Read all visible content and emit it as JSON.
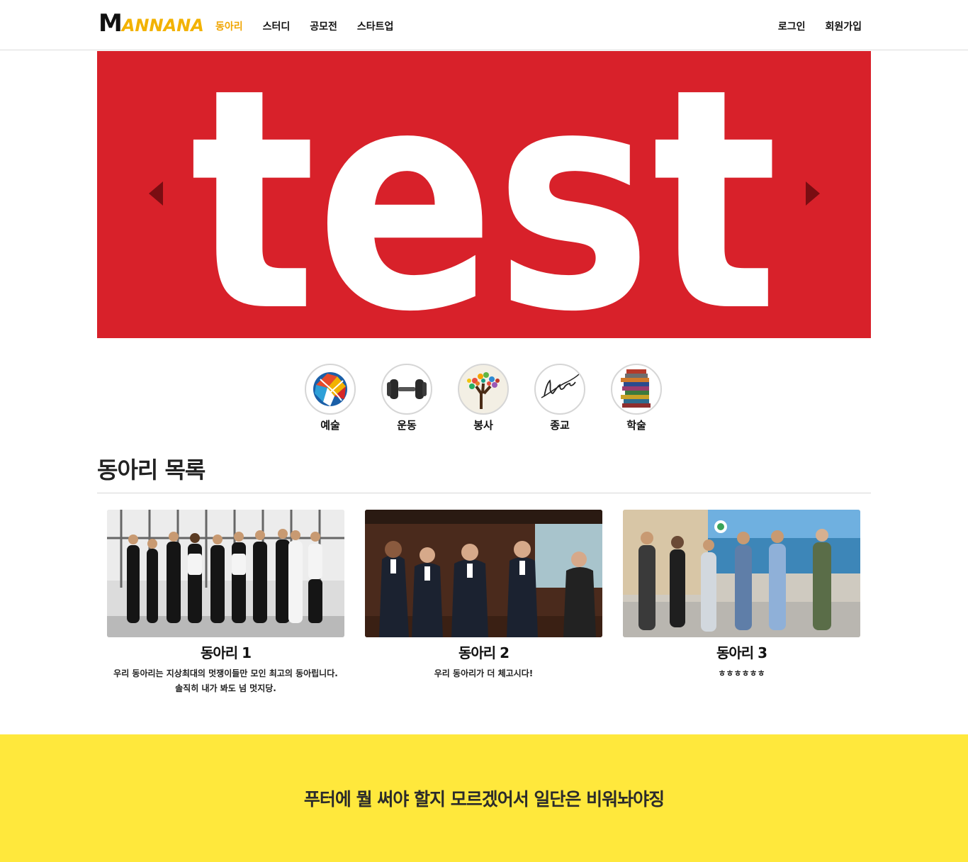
{
  "nav": {
    "logo_first": "M",
    "logo_rest": "ANNANA",
    "menu": [
      {
        "label": "동아리"
      },
      {
        "label": "스터디"
      },
      {
        "label": "공모전"
      },
      {
        "label": "스타트업"
      }
    ],
    "login": "로그인",
    "signup": "회원가입",
    "accent_color": "#f0a500"
  },
  "hero": {
    "word": "test",
    "background_color": "#d8212a"
  },
  "categories": [
    {
      "label": "예술",
      "icon": "art-map-icon"
    },
    {
      "label": "운동",
      "icon": "dumbbell-icon"
    },
    {
      "label": "봉사",
      "icon": "hands-tree-icon"
    },
    {
      "label": "종교",
      "icon": "believe-icon"
    },
    {
      "label": "학술",
      "icon": "books-icon"
    }
  ],
  "section": {
    "title": "동아리 목록"
  },
  "clubs": [
    {
      "title": "동아리 1",
      "desc": "우리 동아리는 지상최대의 멋쟁이들만 모인 최고의 동아립니다.\n솔직히 내가 봐도 넘 멋지당."
    },
    {
      "title": "동아리 2",
      "desc": "우리 동아리가 더 체고시다!"
    },
    {
      "title": "동아리 3",
      "desc": "ㅎㅎㅎㅎㅎㅎ"
    }
  ],
  "footer": {
    "text": "푸터에 뭘 써야 할지 모르겠어서 일단은 비워놔야징",
    "background_color": "#ffe83c"
  }
}
